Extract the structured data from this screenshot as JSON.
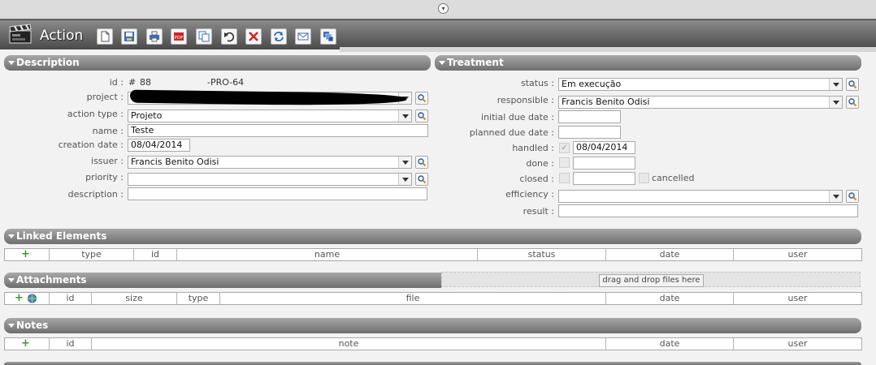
{
  "window": {
    "title": "Action"
  },
  "toolbar": [
    {
      "name": "new-button",
      "icon": "new-document-icon"
    },
    {
      "name": "save-button",
      "icon": "save-icon"
    },
    {
      "name": "print-button",
      "icon": "print-icon"
    },
    {
      "name": "pdf-button",
      "icon": "pdf-icon"
    },
    {
      "name": "copy-button",
      "icon": "copy-icon"
    },
    {
      "name": "undo-button",
      "icon": "undo-icon"
    },
    {
      "name": "delete-button",
      "icon": "delete-icon"
    },
    {
      "name": "refresh-button",
      "icon": "refresh-icon"
    },
    {
      "name": "email-button",
      "icon": "email-icon"
    },
    {
      "name": "multiple-update-button",
      "icon": "multiple-update-icon"
    }
  ],
  "description": {
    "header": "Description",
    "id_label": "id :",
    "id_hash": "#",
    "id_value": "88",
    "id_ref": "-PRO-64",
    "project_label": "project :",
    "project_value": "",
    "action_type_label": "action type :",
    "action_type_value": "Projeto",
    "name_label": "name :",
    "name_value": "Teste",
    "creation_date_label": "creation date :",
    "creation_date_value": "08/04/2014",
    "issuer_label": "issuer :",
    "issuer_value": "Francis Benito Odisi",
    "priority_label": "priority :",
    "priority_value": "",
    "description_label": "description :",
    "description_value": ""
  },
  "treatment": {
    "header": "Treatment",
    "status_label": "status :",
    "status_value": "Em execução",
    "responsible_label": "responsible :",
    "responsible_value": "Francis Benito Odisi",
    "initial_due_label": "initial due date :",
    "initial_due_value": "",
    "planned_due_label": "planned due date :",
    "planned_due_value": "",
    "handled_label": "handled :",
    "handled_checked": true,
    "handled_value": "08/04/2014",
    "done_label": "done :",
    "done_value": "",
    "closed_label": "closed :",
    "closed_value": "",
    "cancelled_label": "cancelled",
    "efficiency_label": "efficiency :",
    "efficiency_value": "",
    "result_label": "result :",
    "result_value": ""
  },
  "linked": {
    "header": "Linked Elements",
    "add": "+",
    "columns": [
      "type",
      "id",
      "name",
      "status",
      "date",
      "user"
    ]
  },
  "attachments": {
    "header": "Attachments",
    "add": "+",
    "drop_label": "drag and drop files here",
    "columns": [
      "id",
      "size",
      "type",
      "file",
      "date",
      "user"
    ]
  },
  "notes": {
    "header": "Notes",
    "add": "+",
    "columns": [
      "id",
      "note",
      "date",
      "user"
    ]
  }
}
